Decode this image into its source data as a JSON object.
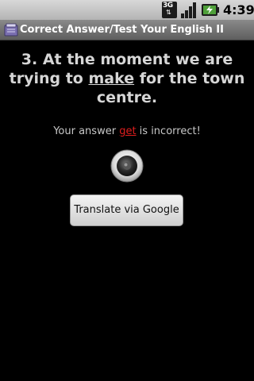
{
  "status_bar": {
    "network_type": "3G",
    "time": "4:39",
    "icons": [
      "3g-data-icon",
      "signal-strength-icon",
      "battery-charging-icon"
    ]
  },
  "title_bar": {
    "title": "Correct Answer/Test Your English II",
    "icon": "app-notebook-icon"
  },
  "question": {
    "prefix": "3. At the moment we are trying to ",
    "underlined_word": "make",
    "suffix": " for the town centre."
  },
  "answer": {
    "prefix": "Your answer ",
    "given_answer": "get",
    "suffix": " is incorrect!"
  },
  "speaker": {
    "icon": "speaker-icon"
  },
  "translate_button": {
    "label": "Translate via Google"
  },
  "colors": {
    "background": "#000000",
    "question_text": "#d6d6d6",
    "wrong_answer": "#e01e1e",
    "title_bar": "#6e6e6e",
    "status_bar": "#c4c4c4"
  }
}
